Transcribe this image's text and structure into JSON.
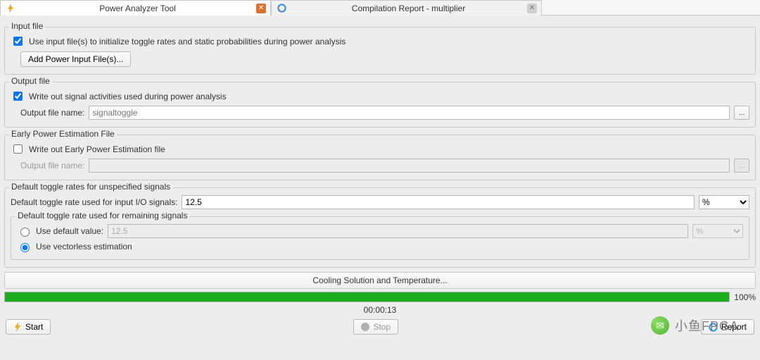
{
  "tabs": [
    {
      "label": "Power Analyzer Tool",
      "active": true
    },
    {
      "label": "Compilation Report - multiplier",
      "active": false
    }
  ],
  "input_file": {
    "legend": "Input file",
    "use_input_files_label": "Use input file(s) to initialize toggle rates and static probabilities during power analysis",
    "use_input_files_checked": true,
    "add_button_label": "Add Power Input File(s)..."
  },
  "output_file": {
    "legend": "Output file",
    "write_out_label": "Write out signal activities used during power analysis",
    "write_out_checked": true,
    "filename_label": "Output file name:",
    "filename_value": "",
    "filename_placeholder": "signaltoggle",
    "browse_label": "..."
  },
  "epe": {
    "legend": "Early Power Estimation File",
    "write_out_label": "Write out Early Power Estimation file",
    "write_out_checked": false,
    "filename_label": "Output file name:",
    "filename_value": "",
    "browse_label": "..."
  },
  "toggle": {
    "legend": "Default toggle rates for unspecified signals",
    "io_label": "Default toggle rate used for input I/O signals:",
    "io_value": "12.5",
    "io_unit_options": [
      "%"
    ],
    "io_unit_selected": "%",
    "remaining_legend": "Default toggle rate used for remaining signals",
    "use_default_label": "Use default value:",
    "use_default_value": "12.5",
    "use_default_unit": "%",
    "vectorless_label": "Use vectorless estimation",
    "selected": "vectorless"
  },
  "cooling": {
    "label": "Cooling Solution and Temperature..."
  },
  "progress": {
    "percent": 100,
    "percent_label": "100%",
    "elapsed": "00:00:13"
  },
  "buttons": {
    "start": "Start",
    "stop": "Stop",
    "report": "Report"
  },
  "watermark": {
    "text": "小鱼FPGA"
  }
}
